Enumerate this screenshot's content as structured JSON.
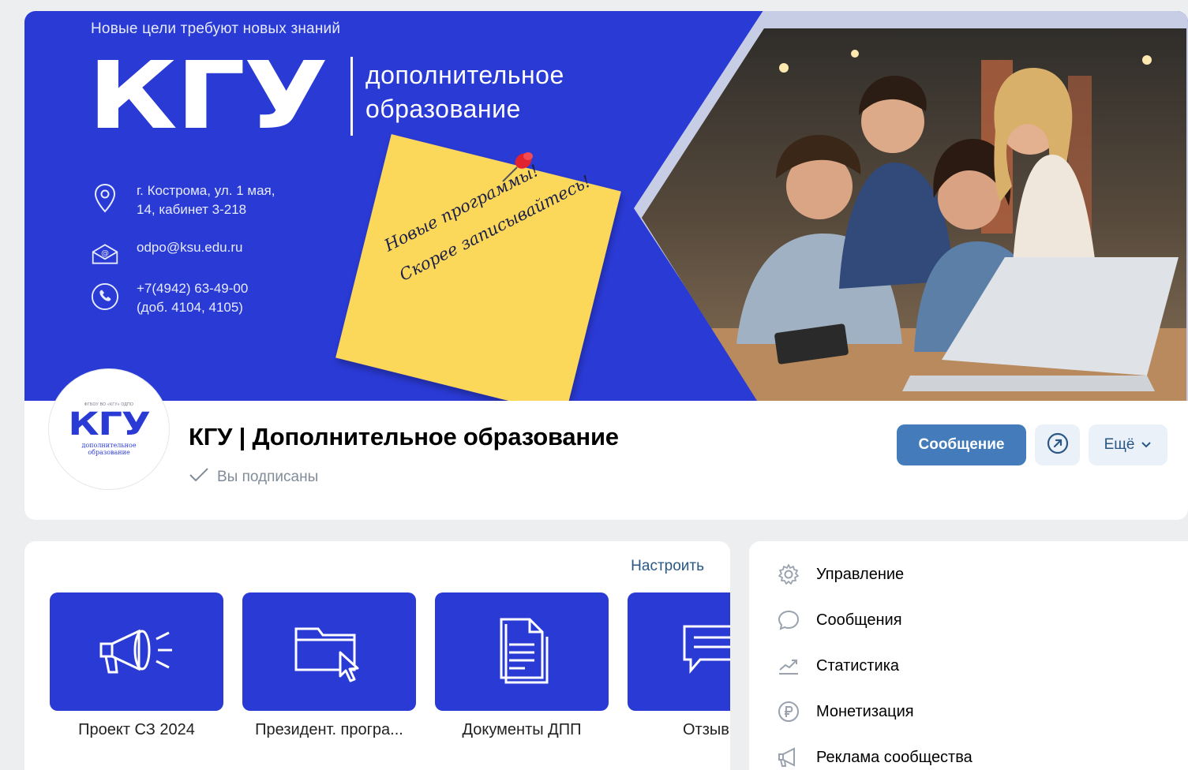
{
  "cover": {
    "slogan": "Новые цели требуют новых знаний",
    "logo": "КГУ",
    "logo_sub_line1": "дополнительное",
    "logo_sub_line2": "образование",
    "address_line1": "г. Кострома, ул. 1 мая,",
    "address_line2": "14, кабинет 3-218",
    "email": "odpo@ksu.edu.ru",
    "phone_line1": "+7(4942) 63-49-00",
    "phone_line2": "(доб. 4104, 4105)",
    "sticky_line1": "Новые программы!",
    "sticky_line2": "Скорее записывайтесь!"
  },
  "header": {
    "avatar_top": "ФГБОУ ВО «КГУ» ОДПО",
    "avatar_logo": "КГУ",
    "avatar_sub_line1": "дополнительное",
    "avatar_sub_line2": "образование",
    "title": "КГУ | Дополнительное образование",
    "subscribed": "Вы подписаны",
    "message_button": "Сообщение",
    "more_button": "Ещё"
  },
  "links": {
    "setup": "Настроить",
    "tiles": [
      {
        "label": "Проект СЗ 2024",
        "icon": "megaphone-icon"
      },
      {
        "label": "Президент. програ...",
        "icon": "folder-icon"
      },
      {
        "label": "Документы ДПП",
        "icon": "document-icon"
      },
      {
        "label": "Отзывы",
        "icon": "chat-icon"
      }
    ]
  },
  "menu": {
    "items": [
      {
        "label": "Управление",
        "icon": "gear-icon"
      },
      {
        "label": "Сообщения",
        "icon": "message-icon"
      },
      {
        "label": "Статистика",
        "icon": "stats-icon"
      },
      {
        "label": "Монетизация",
        "icon": "ruble-icon"
      },
      {
        "label": "Реклама сообщества",
        "icon": "megaphone-icon"
      }
    ]
  },
  "colors": {
    "brand_blue": "#2a3ad4",
    "button_blue": "#447bba",
    "link_blue": "#2a5885",
    "sticky_yellow": "#fbd85a",
    "page_bg": "#edeef0"
  }
}
